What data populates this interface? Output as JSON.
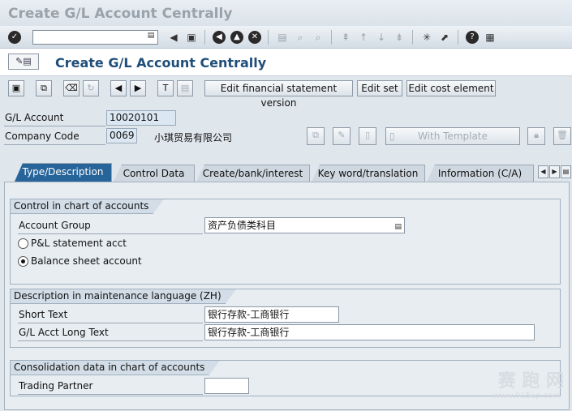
{
  "window": {
    "title": "Create G/L Account Centrally"
  },
  "screen": {
    "title": "Create G/L Account Centrally"
  },
  "app_toolbar": {
    "buttons": [
      "Edit financial statement version",
      "Edit set",
      "Edit cost element"
    ]
  },
  "header": {
    "gl_account_label": "G/L Account",
    "gl_account_value": "10020101",
    "company_code_label": "Company Code",
    "company_code_value": "0069",
    "company_name": "小琪贸易有限公司",
    "with_template_label": "With Template"
  },
  "tabs": [
    {
      "label": "Type/Description",
      "active": true
    },
    {
      "label": "Control Data",
      "active": false
    },
    {
      "label": "Create/bank/interest",
      "active": false
    },
    {
      "label": "Key word/translation",
      "active": false
    },
    {
      "label": "Information (C/A)",
      "active": false
    }
  ],
  "control_group": {
    "title": "Control in chart of accounts",
    "account_group_label": "Account Group",
    "account_group_value": "资产负债类科目",
    "pl_label": "P&L statement acct",
    "bs_label": "Balance sheet account",
    "selected": "Balance sheet account"
  },
  "description_group": {
    "title": "Description in maintenance language (ZH)",
    "short_text_label": "Short Text",
    "short_text_value": "银行存款-工商银行",
    "long_text_label": "G/L Acct Long Text",
    "long_text_value": "银行存款-工商银行"
  },
  "consolidation_group": {
    "title": "Consolidation data in chart of accounts",
    "trading_partner_label": "Trading Partner",
    "trading_partner_value": ""
  },
  "watermark": {
    "text": "赛 跑 网",
    "url": "www.915ap.com"
  },
  "colors": {
    "accent": "#27649a",
    "title": "#1f4e79",
    "field_bg": "#dbe7f2"
  }
}
